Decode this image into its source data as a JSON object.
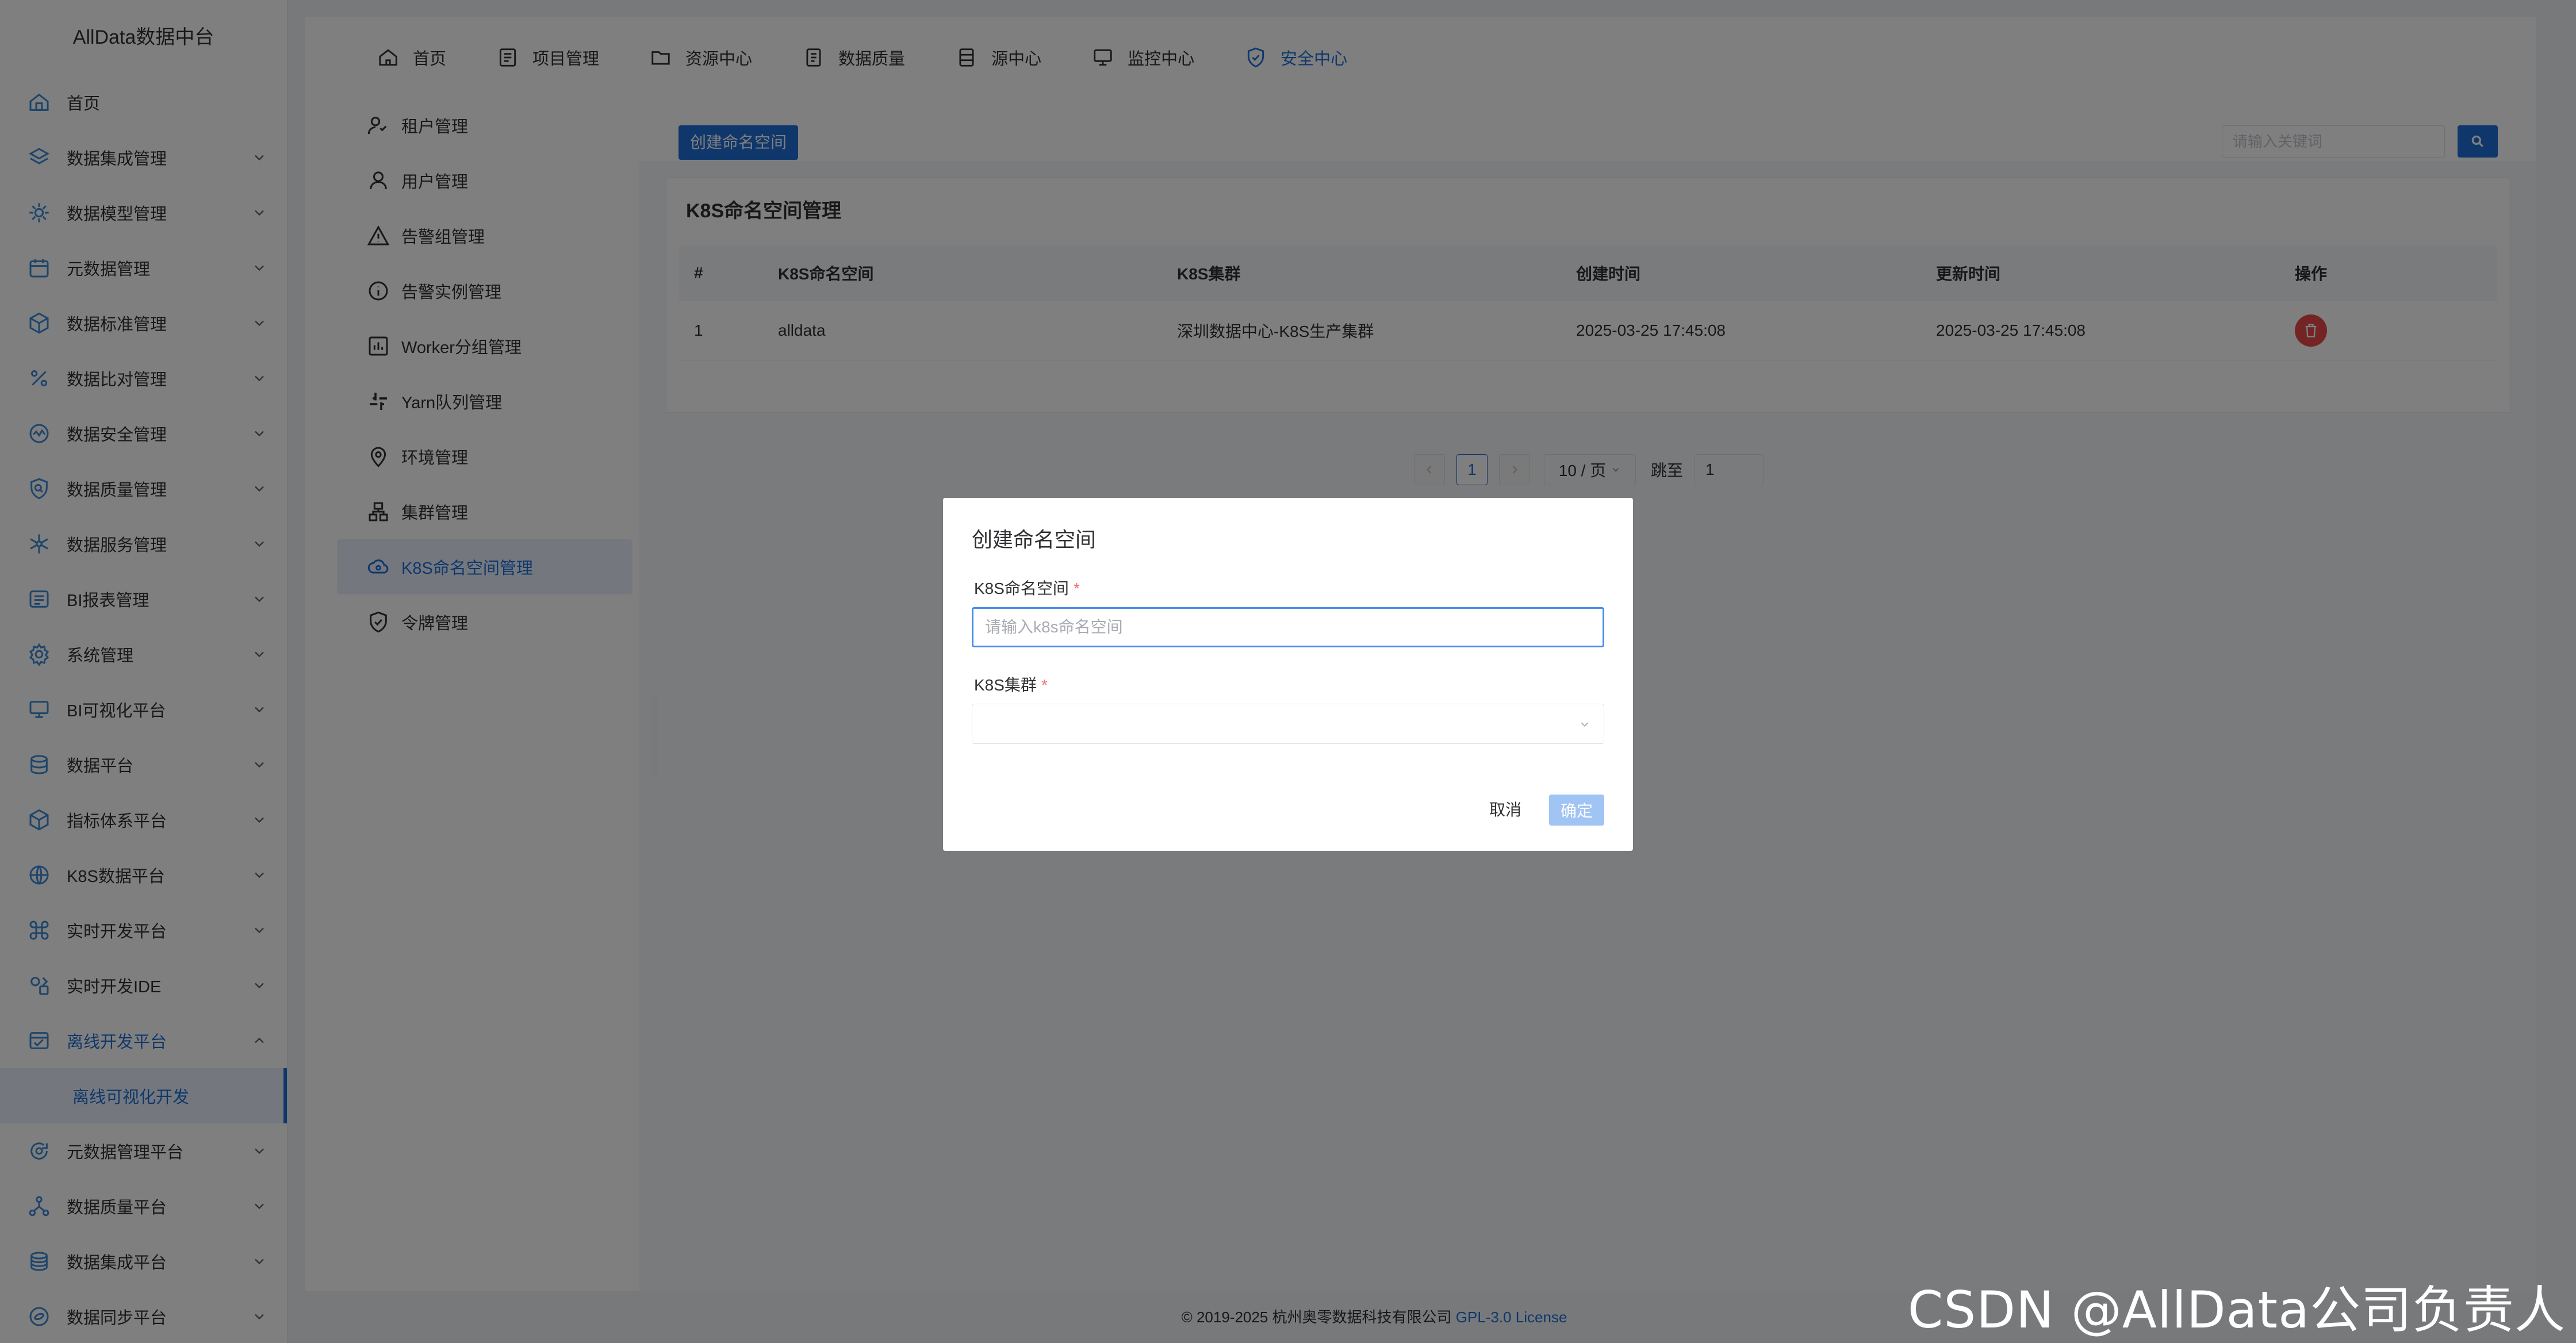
{
  "sidebar": {
    "brand": "AllData数据中台",
    "items": [
      {
        "label": "首页",
        "icon": "home-icon"
      },
      {
        "label": "数据集成管理",
        "icon": "layers-icon"
      },
      {
        "label": "数据模型管理",
        "icon": "model-gear-icon"
      },
      {
        "label": "元数据管理",
        "icon": "calendar-icon"
      },
      {
        "label": "数据标准管理",
        "icon": "cube-icon"
      },
      {
        "label": "数据比对管理",
        "icon": "percent-icon"
      },
      {
        "label": "数据安全管理",
        "icon": "shield-chart-icon"
      },
      {
        "label": "数据质量管理",
        "icon": "search-shield-icon"
      },
      {
        "label": "数据服务管理",
        "icon": "network-icon"
      },
      {
        "label": "BI报表管理",
        "icon": "report-icon"
      },
      {
        "label": "系统管理",
        "icon": "settings-icon"
      },
      {
        "label": "BI可视化平台",
        "icon": "monitor-icon"
      },
      {
        "label": "数据平台",
        "icon": "database-icon"
      },
      {
        "label": "指标体系平台",
        "icon": "box-icon"
      },
      {
        "label": "K8S数据平台",
        "icon": "globe-icon"
      },
      {
        "label": "实时开发平台",
        "icon": "command-icon"
      },
      {
        "label": "实时开发IDE",
        "icon": "ide-icon"
      },
      {
        "label": "离线开发平台",
        "icon": "offline-icon"
      },
      {
        "label": "元数据管理平台",
        "icon": "cycle-icon"
      },
      {
        "label": "数据质量平台",
        "icon": "graph-icon"
      },
      {
        "label": "数据集成平台",
        "icon": "stack-icon"
      },
      {
        "label": "数据同步平台",
        "icon": "sync-icon"
      }
    ],
    "sub_item": "离线可视化开发"
  },
  "topnav": {
    "tabs": [
      {
        "label": "首页",
        "icon": "home-icon"
      },
      {
        "label": "项目管理",
        "icon": "list-icon"
      },
      {
        "label": "资源中心",
        "icon": "folder-icon"
      },
      {
        "label": "数据质量",
        "icon": "document-icon"
      },
      {
        "label": "源中心",
        "icon": "server-icon"
      },
      {
        "label": "监控中心",
        "icon": "monitor-icon"
      },
      {
        "label": "安全中心",
        "icon": "shield-check-icon"
      }
    ]
  },
  "subnav": {
    "items": [
      {
        "label": "租户管理",
        "icon": "users-icon"
      },
      {
        "label": "用户管理",
        "icon": "user-icon"
      },
      {
        "label": "告警组管理",
        "icon": "warning-icon"
      },
      {
        "label": "告警实例管理",
        "icon": "info-icon"
      },
      {
        "label": "Worker分组管理",
        "icon": "chart-box-icon"
      },
      {
        "label": "Yarn队列管理",
        "icon": "slack-icon"
      },
      {
        "label": "环境管理",
        "icon": "location-icon"
      },
      {
        "label": "集群管理",
        "icon": "cluster-icon"
      },
      {
        "label": "K8S命名空间管理",
        "icon": "cloud-icon"
      },
      {
        "label": "令牌管理",
        "icon": "shield-check-icon"
      }
    ]
  },
  "toolbar": {
    "create_label": "创建命名空间",
    "search_placeholder": "请输入关键词"
  },
  "card": {
    "title": "K8S命名空间管理"
  },
  "table": {
    "headers": [
      "#",
      "K8S命名空间",
      "K8S集群",
      "创建时间",
      "更新时间",
      "操作"
    ],
    "rows": [
      {
        "index": "1",
        "namespace": "alldata",
        "cluster": "深圳数据中心-K8S生产集群",
        "created": "2025-03-25 17:45:08",
        "updated": "2025-03-25 17:45:08"
      }
    ]
  },
  "pager": {
    "current": "1",
    "page_size": "10 / 页",
    "jump_label": "跳至",
    "jump_value": "1"
  },
  "footer": {
    "copyright": "© 2019-2025 杭州奥零数据科技有限公司",
    "license": "GPL-3.0 License"
  },
  "watermark": "CSDN @AllData公司负责人",
  "dialog": {
    "title": "创建命名空间",
    "ns_label": "K8S命名空间",
    "ns_placeholder": "请输入k8s命名空间",
    "cluster_label": "K8S集群",
    "required_mark": "*",
    "cancel_label": "取消",
    "ok_label": "确定"
  },
  "colors": {
    "accent": "#1f6fd6",
    "danger": "#e84848",
    "overlay": "rgba(0,0,0,0.5)"
  }
}
